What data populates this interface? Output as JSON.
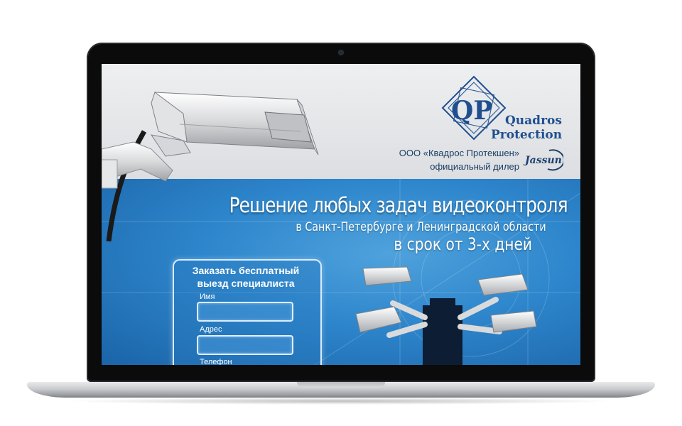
{
  "logo": {
    "monogram": "QP",
    "line1": "Quadros",
    "line2": "Protection",
    "brand": "Jassun"
  },
  "company": {
    "name": "ООО «Квадрос Протекшен»",
    "role": "официальный дилер"
  },
  "hero": {
    "headline": "Решение любых задач видеоконтроля",
    "region": "в Санкт-Петербурге и Ленинградской области",
    "timeframe": "в срок от 3-х дней"
  },
  "form": {
    "title_line1": "Заказать  бесплатный",
    "title_line2": "выезд специалиста",
    "fields": [
      {
        "label": "Имя",
        "value": ""
      },
      {
        "label": "Адрес",
        "value": ""
      },
      {
        "label": "Телефон",
        "value": ""
      }
    ]
  },
  "colors": {
    "brand_blue": "#1f4f8f",
    "banner_blue": "#2e86cc",
    "form_border": "#d8ebff"
  }
}
